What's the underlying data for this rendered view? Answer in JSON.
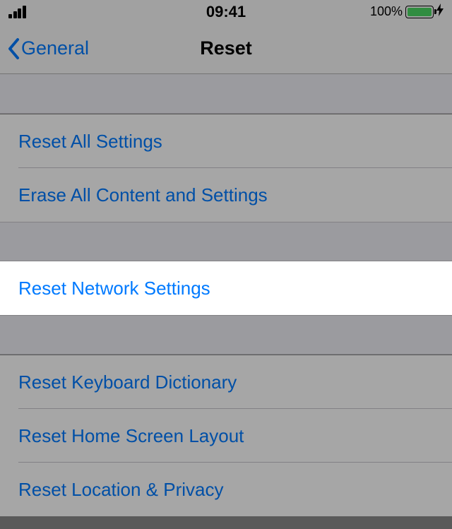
{
  "status": {
    "time": "09:41",
    "battery_text": "100%"
  },
  "nav": {
    "back_label": "General",
    "title": "Reset"
  },
  "groups": {
    "g1": {
      "reset_all": "Reset All Settings",
      "erase_all": "Erase All Content and Settings"
    },
    "g2": {
      "reset_network": "Reset Network Settings"
    },
    "g3": {
      "reset_keyboard": "Reset Keyboard Dictionary",
      "reset_home": "Reset Home Screen Layout",
      "reset_location": "Reset Location & Privacy"
    }
  }
}
